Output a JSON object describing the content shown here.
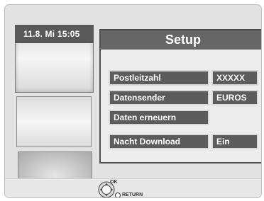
{
  "status": {
    "date_time": "11.8. Mi  15:05"
  },
  "setup": {
    "title": "Setup",
    "rows": [
      {
        "label": "Postleitzahl",
        "value": "XXXXX"
      },
      {
        "label": "Datensender",
        "value": "EUROS"
      },
      {
        "label": "Daten erneuern",
        "value": ""
      },
      {
        "label": "Nacht Download",
        "value": "Ein"
      }
    ]
  },
  "controls": {
    "ok_label": "OK",
    "return_label": "RETURN"
  }
}
